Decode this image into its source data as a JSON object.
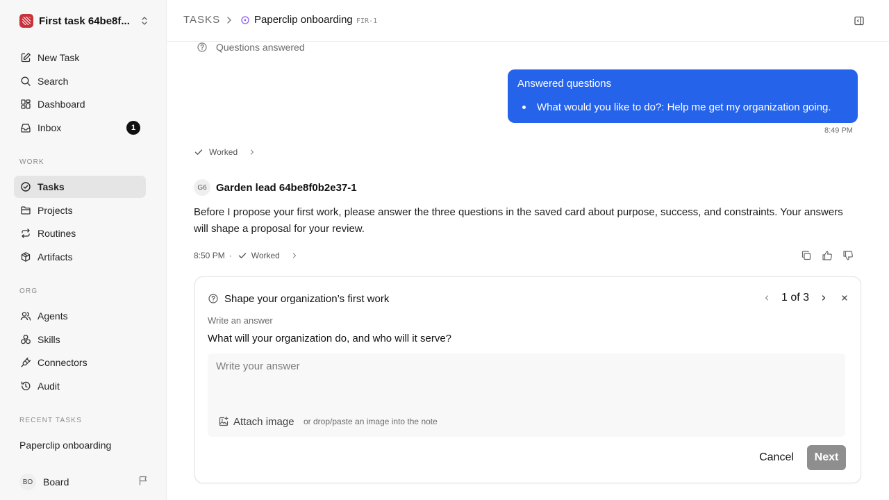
{
  "sidebar": {
    "workspace_name": "First task 64be8f...",
    "nav": {
      "new_task": "New Task",
      "search": "Search",
      "dashboard": "Dashboard",
      "inbox": "Inbox",
      "inbox_count": "1"
    },
    "sections": {
      "work": "WORK",
      "org": "ORG",
      "recent": "RECENT TASKS"
    },
    "work_items": {
      "tasks": "Tasks",
      "projects": "Projects",
      "routines": "Routines",
      "artifacts": "Artifacts"
    },
    "org_items": {
      "agents": "Agents",
      "skills": "Skills",
      "connectors": "Connectors",
      "audit": "Audit"
    },
    "recent_task": "Paperclip onboarding",
    "board": {
      "initials": "BO",
      "name": "Board"
    }
  },
  "header": {
    "breadcrumb_root": "TASKS",
    "task_title": "Paperclip onboarding",
    "task_id": "FIR-1"
  },
  "thread": {
    "questions_answered": "Questions answered",
    "bubble": {
      "title": "Answered questions",
      "item": "What would you like to do?: Help me get my organization going."
    },
    "bubble_time": "8:49 PM",
    "worked_label": "Worked",
    "agent": {
      "initials": "G6",
      "name": "Garden lead 64be8f0b2e37-1"
    },
    "message": "Before I propose your first work, please answer the three questions in the saved card about purpose, success, and constraints. Your answers will shape a proposal for your review.",
    "message_time": "8:50 PM",
    "meta_sep": "·",
    "message_worked": "Worked"
  },
  "card": {
    "title": "Shape your organization’s first work",
    "pager": "1 of 3",
    "hint": "Write an answer",
    "question": "What will your organization do, and who will it serve?",
    "placeholder": "Write your answer",
    "attach_label": "Attach image",
    "drop_hint": "or drop/paste an image into the note",
    "cancel_label": "Cancel",
    "next_label": "Next"
  },
  "colors": {
    "accent_blue": "#2563eb",
    "status_purple": "#8b5cf6",
    "next_disabled": "#8e8e8e"
  },
  "icons": [
    "chevron-updown-icon",
    "edit-icon",
    "search-icon",
    "dashboard-icon",
    "inbox-icon",
    "check-circle-icon",
    "folder-icon",
    "repeat-icon",
    "package-icon",
    "users-icon",
    "skills-icon",
    "plug-icon",
    "history-icon",
    "flag-icon",
    "chevron-right-icon",
    "status-circle-icon",
    "panel-icon",
    "help-circle-icon",
    "check-icon",
    "copy-icon",
    "thumbs-up-icon",
    "thumbs-down-icon",
    "chevron-left-icon",
    "close-icon",
    "image-plus-icon"
  ]
}
